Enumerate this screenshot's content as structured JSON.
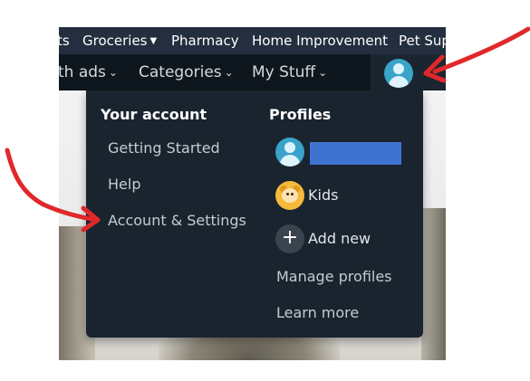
{
  "topnav": {
    "items": [
      {
        "label": "ts",
        "caret": false
      },
      {
        "label": "Groceries",
        "caret": true
      },
      {
        "label": "Pharmacy",
        "caret": false
      },
      {
        "label": "Home Improvement",
        "caret": false
      },
      {
        "label": "Pet Sup",
        "caret": false
      }
    ]
  },
  "secnav": {
    "items": [
      {
        "label": "th ads"
      },
      {
        "label": "Categories"
      },
      {
        "label": "My Stuff"
      }
    ]
  },
  "menu": {
    "account_title": "Your account",
    "account_links": [
      "Getting Started",
      "Help",
      "Account & Settings"
    ],
    "profiles_title": "Profiles",
    "profiles": [
      {
        "name": "",
        "avatar": "user-avatar-icon"
      },
      {
        "name": "Kids",
        "avatar": "kids-avatar-icon"
      },
      {
        "name": "Add new",
        "avatar": "plus-icon"
      }
    ],
    "manage_profiles": "Manage profiles",
    "learn_more": "Learn more"
  },
  "colors": {
    "topbar": "#232f3e",
    "secbar": "#0f171e",
    "menu_bg": "#1a242f",
    "annotation": "#e0282a",
    "redaction": "#3f73d0"
  }
}
